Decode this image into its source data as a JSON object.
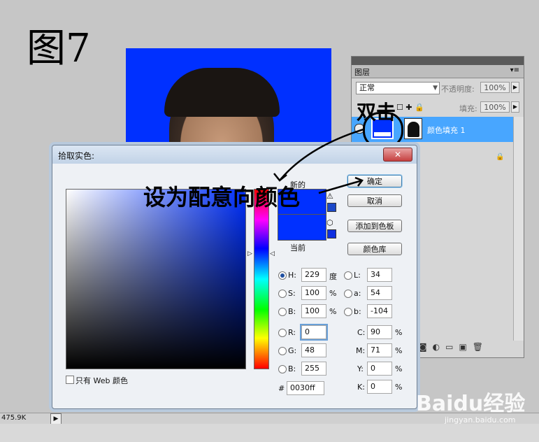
{
  "annotations": {
    "figure_label": "图7",
    "double_click_note": "双击",
    "pick_color_note": "设为配意向颜色"
  },
  "layers_panel": {
    "tab": "图层",
    "blend_mode": "正常",
    "opacity_label": "不透明度:",
    "opacity_value": "100%",
    "fill_label": "填充:",
    "fill_value": "100%",
    "layer_name": "颜色填充 1"
  },
  "dialog": {
    "title": "拾取实色:",
    "new_label": "新的",
    "current_label": "当前",
    "buttons": {
      "ok": "确定",
      "cancel": "取消",
      "add_swatch": "添加到色板",
      "libraries": "颜色库"
    },
    "fields": {
      "H": {
        "label": "H:",
        "value": "229",
        "unit": "度"
      },
      "S": {
        "label": "S:",
        "value": "100",
        "unit": "%"
      },
      "B": {
        "label": "B:",
        "value": "100",
        "unit": "%"
      },
      "R": {
        "label": "R:",
        "value": "0"
      },
      "G": {
        "label": "G:",
        "value": "48"
      },
      "Bl": {
        "label": "B:",
        "value": "255"
      },
      "L": {
        "label": "L:",
        "value": "34"
      },
      "a": {
        "label": "a:",
        "value": "54"
      },
      "b": {
        "label": "b:",
        "value": "-104"
      },
      "C": {
        "label": "C:",
        "value": "90",
        "unit": "%"
      },
      "M": {
        "label": "M:",
        "value": "71",
        "unit": "%"
      },
      "Y": {
        "label": "Y:",
        "value": "0",
        "unit": "%"
      },
      "K": {
        "label": "K:",
        "value": "0",
        "unit": "%"
      },
      "hex": {
        "label": "#",
        "value": "0030ff"
      }
    },
    "web_only_label": "只有 Web 颜色",
    "selected_color": "#0030ff"
  },
  "statusbar": {
    "doc_size": "475.9K"
  },
  "watermark": {
    "brand": "Baidu经验",
    "url": "jingyan.baidu.com"
  }
}
